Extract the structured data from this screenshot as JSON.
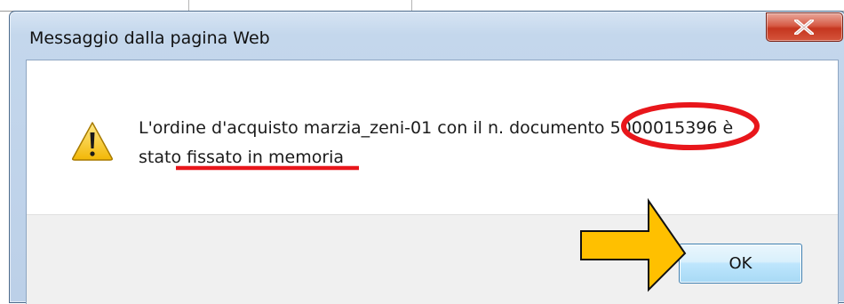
{
  "dialog": {
    "title": "Messaggio dalla pagina Web",
    "close_label": "X",
    "message_line1": "L'ordine d'acquisto marzia_zeni-01 con il n. documento 5000015396 è",
    "message_line2_a": "stato ",
    "message_line2_b": "fissato in memoria",
    "ok_label": "OK"
  },
  "icons": {
    "warning": "warning-icon",
    "close": "close-icon",
    "pointer": "arrow-right-icon"
  },
  "colors": {
    "annotation_red": "#e8161b",
    "arrow_fill": "#ffc000",
    "warning_yellow": "#f5c518",
    "close_red": "#c9412a",
    "ok_border": "#3c7fb1"
  }
}
